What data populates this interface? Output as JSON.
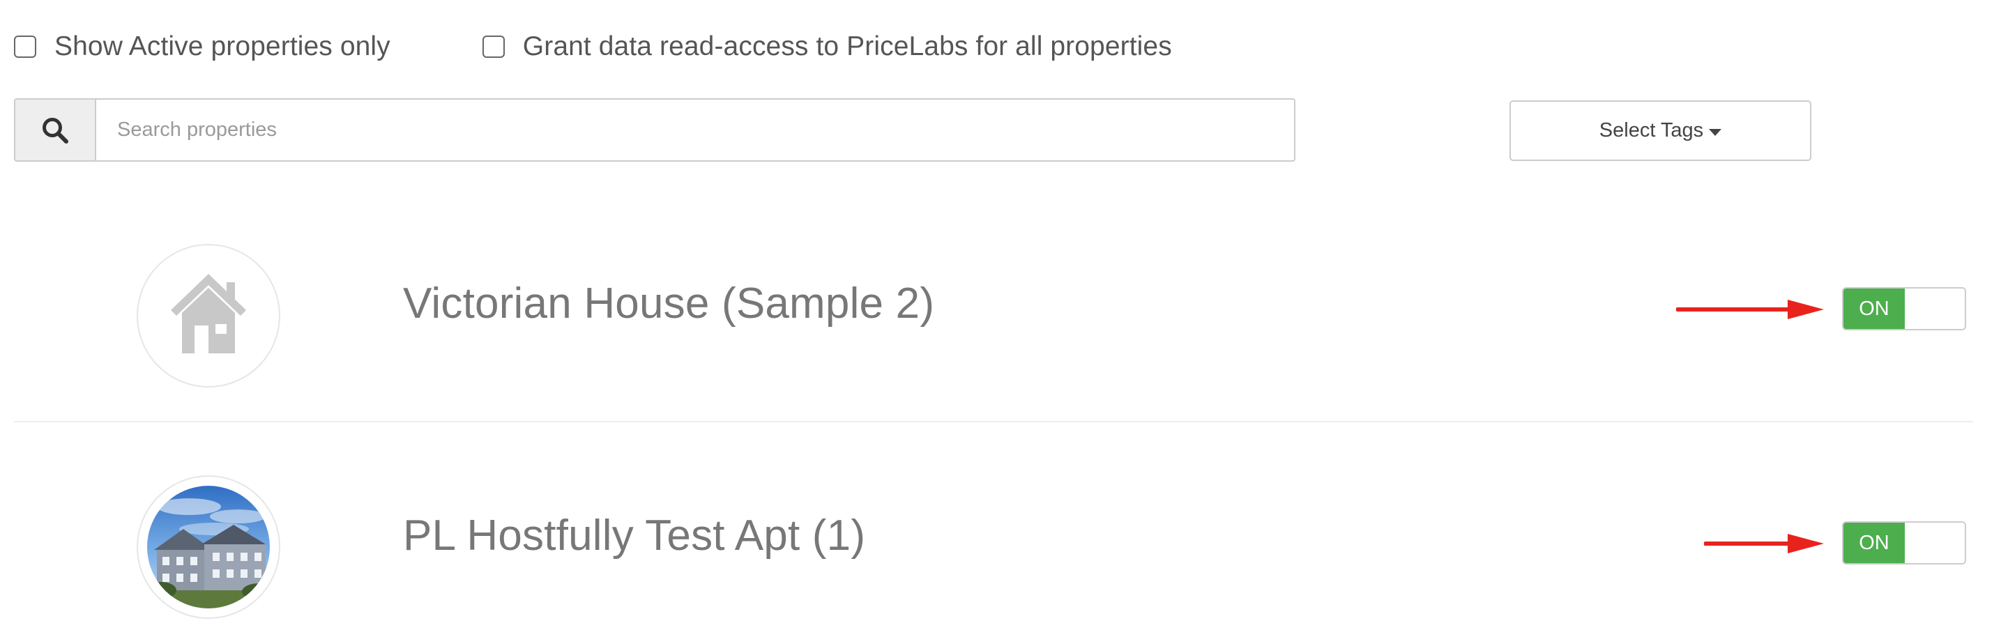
{
  "filters": {
    "active_only_label": "Show Active properties only",
    "grant_access_label": "Grant data read-access to PriceLabs for all properties"
  },
  "search": {
    "icon": "search-icon",
    "placeholder": "Search properties",
    "value": ""
  },
  "tags": {
    "label": "Select Tags"
  },
  "properties": [
    {
      "name": "Victorian House (Sample 2)",
      "avatar": "house-icon",
      "toggle_label": "ON",
      "arrow": "red-arrow"
    },
    {
      "name": "PL Hostfully Test Apt (1)",
      "avatar": "property-photo",
      "toggle_label": "ON",
      "arrow": "red-arrow"
    }
  ],
  "colors": {
    "toggle_on": "#4cae4c",
    "annotation_arrow": "#e8231e",
    "placeholder_icon": "#c8c8c8"
  }
}
